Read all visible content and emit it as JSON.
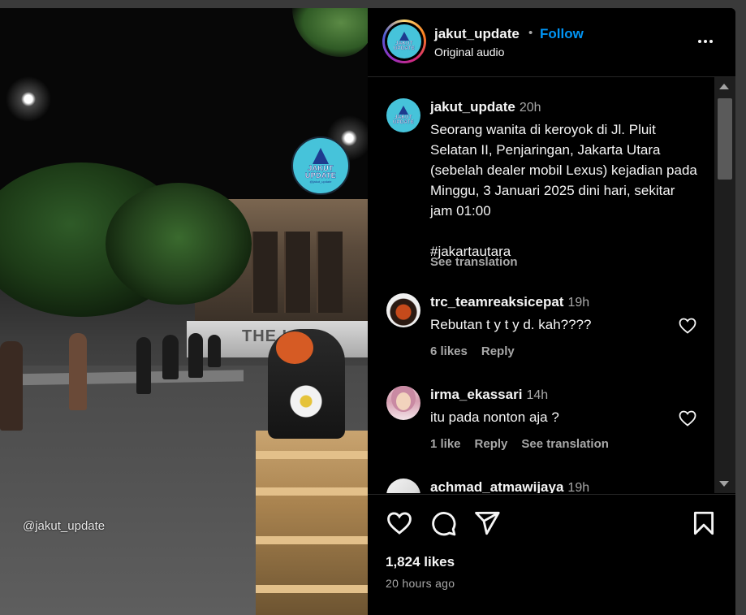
{
  "post": {
    "username": "jakut_update",
    "dot": "•",
    "follow_label": "Follow",
    "audio": "Original audio",
    "more_icon": "more-horizontal-icon"
  },
  "media": {
    "watermark": "@jakut_update",
    "logo_title": "JAKUT UPDATE",
    "logo_handle": "@jakut_update",
    "wall_sign": "THE L  OP"
  },
  "caption": {
    "username": "jakut_update",
    "time": "20h",
    "text": "Seorang wanita di keroyok di Jl. Pluit Selatan II, Penjaringan, Jakarta Utara (sebelah dealer mobil Lexus) kejadian pada Minggu, 3 Januari 2025 dini hari, sekitar jam 01:00\n\n#jakartautara",
    "see_translation": "See translation"
  },
  "comments": [
    {
      "username": "trc_teamreaksicepat",
      "time": "19h",
      "text": "Rebutan t y t y d. kah????",
      "likes": "6 likes",
      "reply": "Reply"
    },
    {
      "username": "irma_ekassari",
      "time": "14h",
      "text": "itu pada nonton aja ?",
      "likes": "1 like",
      "reply": "Reply",
      "see_translation": "See translation"
    },
    {
      "username": "achmad_atmawijaya",
      "time": "19h"
    }
  ],
  "footer": {
    "likes": "1,824 likes",
    "posted": "20 hours ago"
  },
  "colors": {
    "accent": "#0095f6",
    "background": "#000000",
    "text": "#f5f5f5",
    "muted": "#a8a8a8"
  }
}
